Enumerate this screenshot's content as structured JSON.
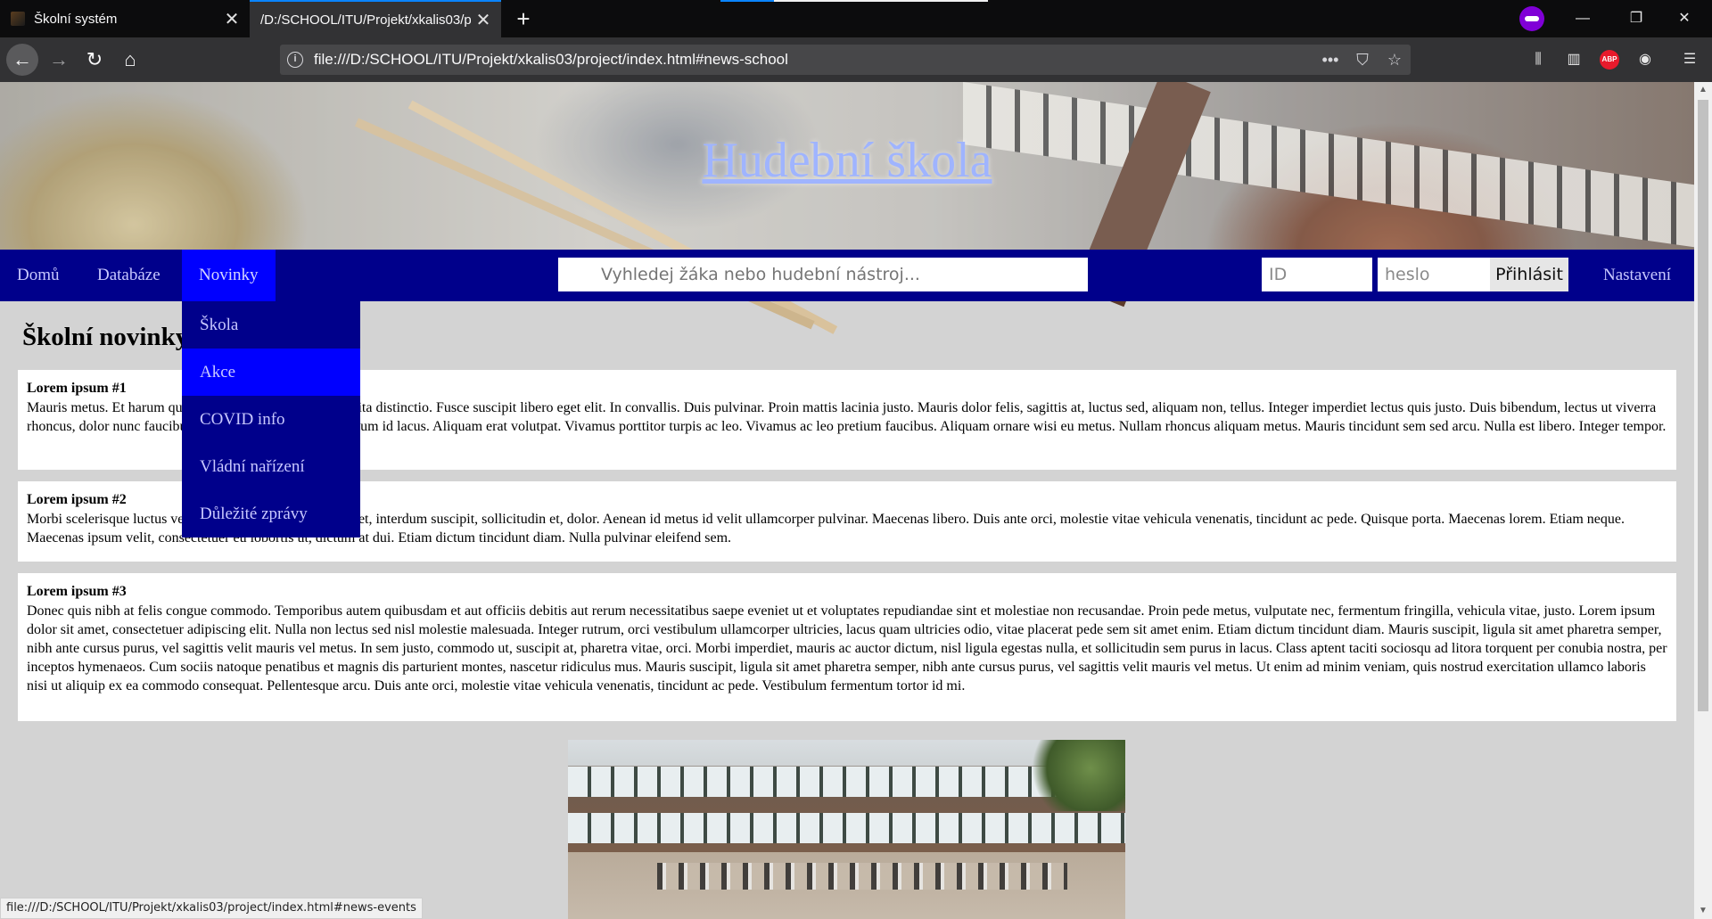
{
  "browser": {
    "tabs": [
      {
        "title": "Školní systém",
        "close": "✕"
      },
      {
        "title": "/D:/SCHOOL/ITU/Projekt/xkalis03/p",
        "close": "✕"
      }
    ],
    "new_tab": "+",
    "window": {
      "minimize": "—",
      "restore": "❐",
      "close": "✕"
    },
    "nav": {
      "back": "←",
      "forward": "→",
      "reload": "↻",
      "home": "⌂"
    },
    "url": "file:///D:/SCHOOL/ITU/Projekt/xkalis03/project/index.html#news-school",
    "url_actions": {
      "more": "•••",
      "pocket": "⛉",
      "bookmark": "☆"
    },
    "toolbar": {
      "library": "⫼",
      "sidebar": "▥",
      "abp": "ABP",
      "account": "◉",
      "menu": "☰"
    },
    "status_text": "file:///D:/SCHOOL/ITU/Projekt/xkalis03/project/index.html#news-events",
    "colors": {
      "chrome_dark": "#0c0c0d",
      "toolbar": "#323234",
      "accent": "#0a84ff",
      "private": "#8000d7"
    }
  },
  "page": {
    "hero_title": "Hudební škola",
    "menu": {
      "items": [
        "Domů",
        "Databáze",
        "Novinky"
      ],
      "active_item": "Novinky",
      "settings": "Nastavení"
    },
    "search": {
      "placeholder": "Vyhledej žáka nebo hudební nástroj..."
    },
    "login": {
      "id_placeholder": "ID",
      "password_placeholder": "heslo",
      "button": "Přihlásit"
    },
    "dropdown": {
      "items": [
        "Škola",
        "Akce",
        "COVID info",
        "Vládní nařízení",
        "Důležité zprávy"
      ],
      "hovered": "Akce"
    },
    "section_title": "Školní novinky",
    "news": [
      {
        "title": "Lorem ipsum #1",
        "text": "Mauris metus. Et harum quidem rerum facilis est et expedita distinctio. Fusce suscipit libero eget elit. In convallis. Duis pulvinar. Proin mattis lacinia justo. Mauris dolor felis, sagittis at, luctus sed, aliquam non, tellus. Integer imperdiet lectus quis justo. Duis bibendum, lectus ut viverra rhoncus, dolor nunc faucibus libero, eget facilisis enim ipsum id lacus. Aliquam erat volutpat. Vivamus porttitor turpis ac leo. Vivamus ac leo pretium faucibus. Aliquam ornare wisi eu metus. Nullam rhoncus aliquam metus. Mauris tincidunt sem sed arcu. Nulla est libero. Integer tempor."
      },
      {
        "title": "Lorem ipsum #2",
        "text": "Morbi scelerisque luctus velit. Nulla quis diam commodo et, interdum suscipit, sollicitudin et, dolor. Aenean id metus id velit ullamcorper pulvinar. Maecenas libero. Duis ante orci, molestie vitae vehicula venenatis, tincidunt ac pede. Quisque porta. Maecenas lorem. Etiam neque. Maecenas ipsum velit, consectetuer eu lobortis ut, dictum at dui. Etiam dictum tincidunt diam. Nulla pulvinar eleifend sem."
      },
      {
        "title": "Lorem ipsum #3",
        "text": "Donec quis nibh at felis congue commodo. Temporibus autem quibusdam et aut officiis debitis aut rerum necessitatibus saepe eveniet ut et voluptates repudiandae sint et molestiae non recusandae. Proin pede metus, vulputate nec, fermentum fringilla, vehicula vitae, justo. Lorem ipsum dolor sit amet, consectetuer adipiscing elit. Nulla non lectus sed nisl molestie malesuada. Integer rutrum, orci vestibulum ullamcorper ultricies, lacus quam ultricies odio, vitae placerat pede sem sit amet enim. Etiam dictum tincidunt diam. Mauris suscipit, ligula sit amet pharetra semper, nibh ante cursus purus, vel sagittis velit mauris vel metus. In sem justo, commodo ut, suscipit at, pharetra vitae, orci. Morbi imperdiet, mauris ac auctor dictum, nisl ligula egestas nulla, et sollicitudin sem purus in lacus. Class aptent taciti sociosqu ad litora torquent per conubia nostra, per inceptos hymenaeos. Cum sociis natoque penatibus et magnis dis parturient montes, nascetur ridiculus mus. Mauris suscipit, ligula sit amet pharetra semper, nibh ante cursus purus, vel sagittis velit mauris vel metus. Ut enim ad minim veniam, quis nostrud exercitation ullamco laboris nisi ut aliquip ex ea commodo consequat. Pellentesque arcu. Duis ante orci, molestie vitae vehicula venenatis, tincidunt ac pede. Vestibulum fermentum tortor id mi."
      }
    ],
    "colors": {
      "menu_bg": "#00008b",
      "menu_active": "#0000ff",
      "page_bg": "#d3d3d3",
      "hero_title": "#9fb4ff"
    }
  }
}
